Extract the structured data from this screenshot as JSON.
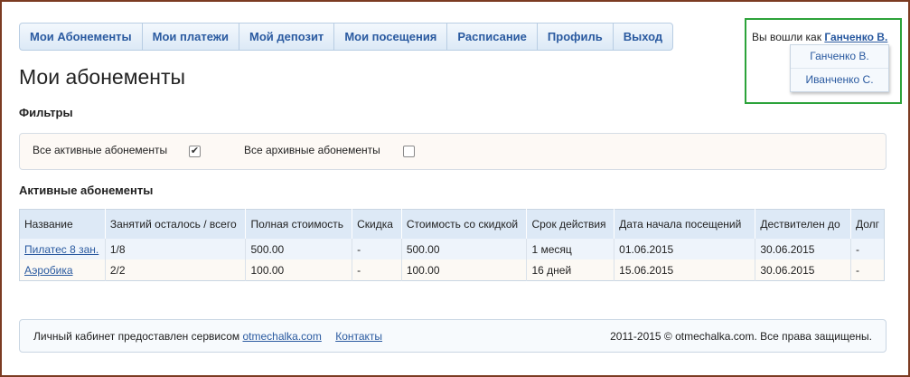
{
  "nav": {
    "items": [
      {
        "label": "Мои Абонементы"
      },
      {
        "label": "Мои платежи"
      },
      {
        "label": "Мой депозит"
      },
      {
        "label": "Мои посещения"
      },
      {
        "label": "Расписание"
      },
      {
        "label": "Профиль"
      },
      {
        "label": "Выход"
      }
    ]
  },
  "login": {
    "prefix": "Вы вошли как",
    "user": "Ганченко В.",
    "dropdown": [
      "Ганченко В.",
      "Иванченко С."
    ]
  },
  "page_title": "Мои абонементы",
  "filters": {
    "title": "Фильтры",
    "active_label": "Все активные абонементы",
    "active_checked": true,
    "archive_label": "Все архивные абонементы",
    "archive_checked": false
  },
  "active_section": {
    "title": "Активные абонементы",
    "columns": [
      "Название",
      "Занятий осталось / всего",
      "Полная стоимость",
      "Скидка",
      "Стоимость со скидкой",
      "Срок действия",
      "Дата начала посещений",
      "Дествителен до",
      "Долг"
    ],
    "rows": [
      [
        "Пилатес 8 зан.",
        "1/8",
        "500.00",
        "-",
        "500.00",
        "1 месяц",
        "01.06.2015",
        "30.06.2015",
        "-"
      ],
      [
        "Аэробика",
        "2/2",
        "100.00",
        "-",
        "100.00",
        "16 дней",
        "15.06.2015",
        "30.06.2015",
        "-"
      ]
    ]
  },
  "footer": {
    "service_text": "Личный кабинет предоставлен сервисом",
    "service_link": "otmechalka.com",
    "contacts": "Контакты",
    "copyright": "2011-2015 © otmechalka.com. Все права защищены."
  }
}
